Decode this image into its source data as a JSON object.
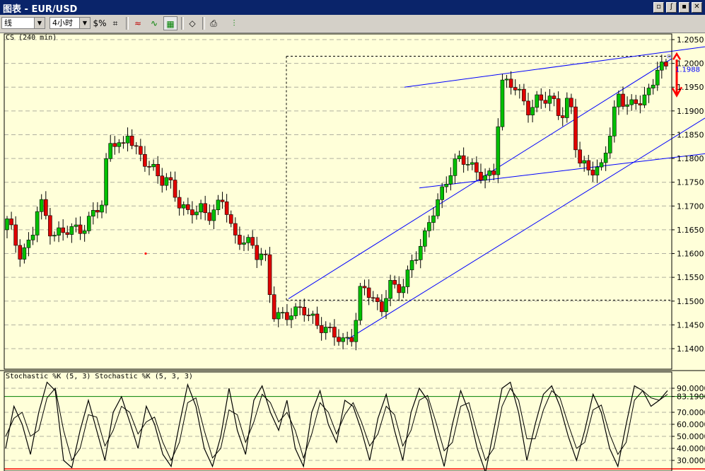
{
  "window": {
    "title": "图表 - EUR/USD",
    "buttons": [
      "▫",
      "ʃ",
      "▪",
      "✕"
    ]
  },
  "toolbar": {
    "chart_type": "线",
    "period": "4小时",
    "icons": [
      "dollar-percent-icon",
      "crosshair-icon",
      "zoom-chart-icon",
      "line-chart-icon",
      "grid-icon",
      "eraser-icon",
      "print-icon",
      "bar-settings-icon"
    ]
  },
  "colors": {
    "background": "#ffffd9",
    "bull": "#00c000",
    "bear": "#e00000",
    "trendline": "#0000ff",
    "axis_text": "#000000",
    "price_marker": "#0000ff",
    "signal_arrow": "#ff0000",
    "stoch_reference": "#008000",
    "stoch_low": "#ff0000"
  },
  "chart_data": [
    {
      "type": "candlestick",
      "title": "CS (240 min)",
      "symbol": "EUR/USD",
      "ylim": [
        1.137,
        1.207
      ],
      "y_ticks": [
        "1.2050",
        "1.2000",
        "1.1950",
        "1.1900",
        "1.1850",
        "1.1800",
        "1.1750",
        "1.1700",
        "1.1650",
        "1.1600",
        "1.1550",
        "1.1500",
        "1.1450",
        "1.1400"
      ],
      "current_price_label": "1.1988",
      "grid": "dashed horizontal",
      "candle_count": 154,
      "close_path": [
        [
          0,
          1.1665
        ],
        [
          3,
          1.1605
        ],
        [
          6,
          1.1625
        ],
        [
          7,
          1.1665
        ],
        [
          8,
          1.171
        ],
        [
          11,
          1.165
        ],
        [
          14,
          1.164
        ],
        [
          18,
          1.1655
        ],
        [
          21,
          1.1675
        ],
        [
          24,
          1.1705
        ],
        [
          25,
          1.1835
        ],
        [
          27,
          1.1845
        ],
        [
          29,
          1.1815
        ],
        [
          30,
          1.1845
        ],
        [
          33,
          1.181
        ],
        [
          35,
          1.1795
        ],
        [
          38,
          1.1745
        ],
        [
          40,
          1.1765
        ],
        [
          43,
          1.1705
        ],
        [
          45,
          1.1675
        ],
        [
          48,
          1.1705
        ],
        [
          50,
          1.168
        ],
        [
          53,
          1.1695
        ],
        [
          54,
          1.1715
        ],
        [
          57,
          1.163
        ],
        [
          59,
          1.1625
        ],
        [
          62,
          1.16
        ],
        [
          64,
          1.1615
        ],
        [
          66,
          1.147
        ],
        [
          69,
          1.146
        ],
        [
          71,
          1.149
        ],
        [
          74,
          1.1475
        ],
        [
          77,
          1.145
        ],
        [
          79,
          1.1455
        ],
        [
          81,
          1.1425
        ],
        [
          84,
          1.141
        ],
        [
          86,
          1.1435
        ],
        [
          88,
          1.1525
        ],
        [
          91,
          1.1505
        ],
        [
          93,
          1.148
        ],
        [
          95,
          1.1545
        ],
        [
          97,
          1.151
        ],
        [
          99,
          1.154
        ],
        [
          101,
          1.1595
        ],
        [
          104,
          1.163
        ],
        [
          106,
          1.1685
        ],
        [
          109,
          1.1755
        ],
        [
          111,
          1.178
        ],
        [
          113,
          1.1795
        ],
        [
          115,
          1.1795
        ],
        [
          117,
          1.1775
        ],
        [
          119,
          1.1755
        ],
        [
          121,
          1.1755
        ],
        [
          123,
          1.1965
        ],
        [
          125,
          1.1965
        ],
        [
          128,
          1.192
        ],
        [
          130,
          1.1905
        ],
        [
          132,
          1.193
        ],
        [
          134,
          1.192
        ],
        [
          136,
          1.1915
        ],
        [
          138,
          1.1895
        ],
        [
          140,
          1.1935
        ],
        [
          142,
          1.1785
        ],
        [
          144,
          1.178
        ],
        [
          146,
          1.1785
        ],
        [
          148,
          1.178
        ],
        [
          150,
          1.1845
        ],
        [
          152,
          1.1935
        ],
        [
          154,
          1.1925
        ],
        [
          156,
          1.1905
        ],
        [
          158,
          1.192
        ],
        [
          160,
          1.1945
        ],
        [
          162,
          1.2005
        ],
        [
          164,
          1.198
        ]
      ],
      "annotations": [
        {
          "kind": "horizontal-dashed",
          "value": 1.2015
        },
        {
          "kind": "horizontal-dashed",
          "value": 1.1502
        },
        {
          "kind": "trendline",
          "label": "upper channel"
        },
        {
          "kind": "trendline",
          "label": "lower channel"
        },
        {
          "kind": "trendline",
          "label": "resistance"
        },
        {
          "kind": "trendline",
          "label": "support"
        }
      ]
    },
    {
      "type": "line",
      "title": "Stochastic %K (5, 3)   Stochastic %K (5, 3, 3)",
      "ylim": [
        20,
        100
      ],
      "y_ticks": [
        "90.0000",
        "83.1900",
        "70.0000",
        "60.0000",
        "50.0000",
        "40.0000",
        "30.0000"
      ],
      "reference_line": 83.19,
      "series": [
        {
          "values": [
            40,
            75,
            60,
            35,
            70,
            95,
            88,
            30,
            24,
            55,
            80,
            55,
            30,
            70,
            83,
            62,
            40,
            75,
            60,
            35,
            25,
            60,
            93,
            75,
            40,
            25,
            50,
            90,
            55,
            35,
            80,
            92,
            70,
            55,
            80,
            40,
            25,
            70,
            88,
            60,
            45,
            80,
            75,
            55,
            30,
            65,
            85,
            55,
            30,
            70,
            90,
            80,
            50,
            25,
            60,
            88,
            70,
            40,
            20,
            55,
            90,
            95,
            70,
            30,
            60,
            85,
            92,
            75,
            50,
            30,
            55,
            85,
            70,
            40,
            25,
            60,
            92,
            88,
            75,
            80,
            88
          ]
        },
        {
          "values": [
            50,
            65,
            70,
            50,
            55,
            82,
            90,
            55,
            30,
            40,
            68,
            66,
            42,
            55,
            75,
            70,
            52,
            62,
            66,
            45,
            30,
            45,
            78,
            82,
            55,
            32,
            40,
            72,
            68,
            45,
            62,
            85,
            78,
            62,
            70,
            55,
            32,
            52,
            78,
            70,
            52,
            68,
            78,
            62,
            42,
            52,
            75,
            68,
            42,
            55,
            80,
            84,
            62,
            38,
            45,
            75,
            78,
            52,
            30,
            40,
            75,
            90,
            80,
            48,
            48,
            72,
            88,
            82,
            60,
            40,
            45,
            72,
            76,
            52,
            35,
            45,
            80,
            88,
            82,
            80,
            85
          ]
        }
      ]
    }
  ]
}
